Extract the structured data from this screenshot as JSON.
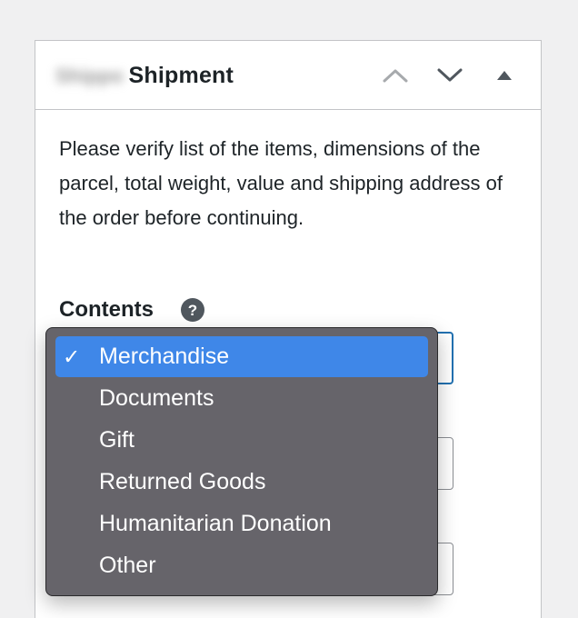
{
  "header": {
    "brand_blurred": "Shippo",
    "title": "Shipment"
  },
  "icons": {
    "move_up": "chevron-up-icon",
    "move_down": "chevron-down-icon",
    "toggle": "triangle-up-icon"
  },
  "instructions": "Please verify list of the items, dimensions of the parcel, total weight, value and shipping address of the order before continuing.",
  "contents": {
    "label": "Contents",
    "help_symbol": "?"
  },
  "dropdown": {
    "check_mark": "✓",
    "options": [
      "Merchandise",
      "Documents",
      "Gift",
      "Returned Goods",
      "Humanitarian Donation",
      "Other"
    ],
    "selected": "Merchandise"
  },
  "colors": {
    "background": "#f0f0f1",
    "panel": "#ffffff",
    "border": "#c3c4c7",
    "focus": "#2271b1",
    "menu_bg": "#66646a",
    "highlight": "#3f87e8",
    "text": "#1d2327"
  }
}
